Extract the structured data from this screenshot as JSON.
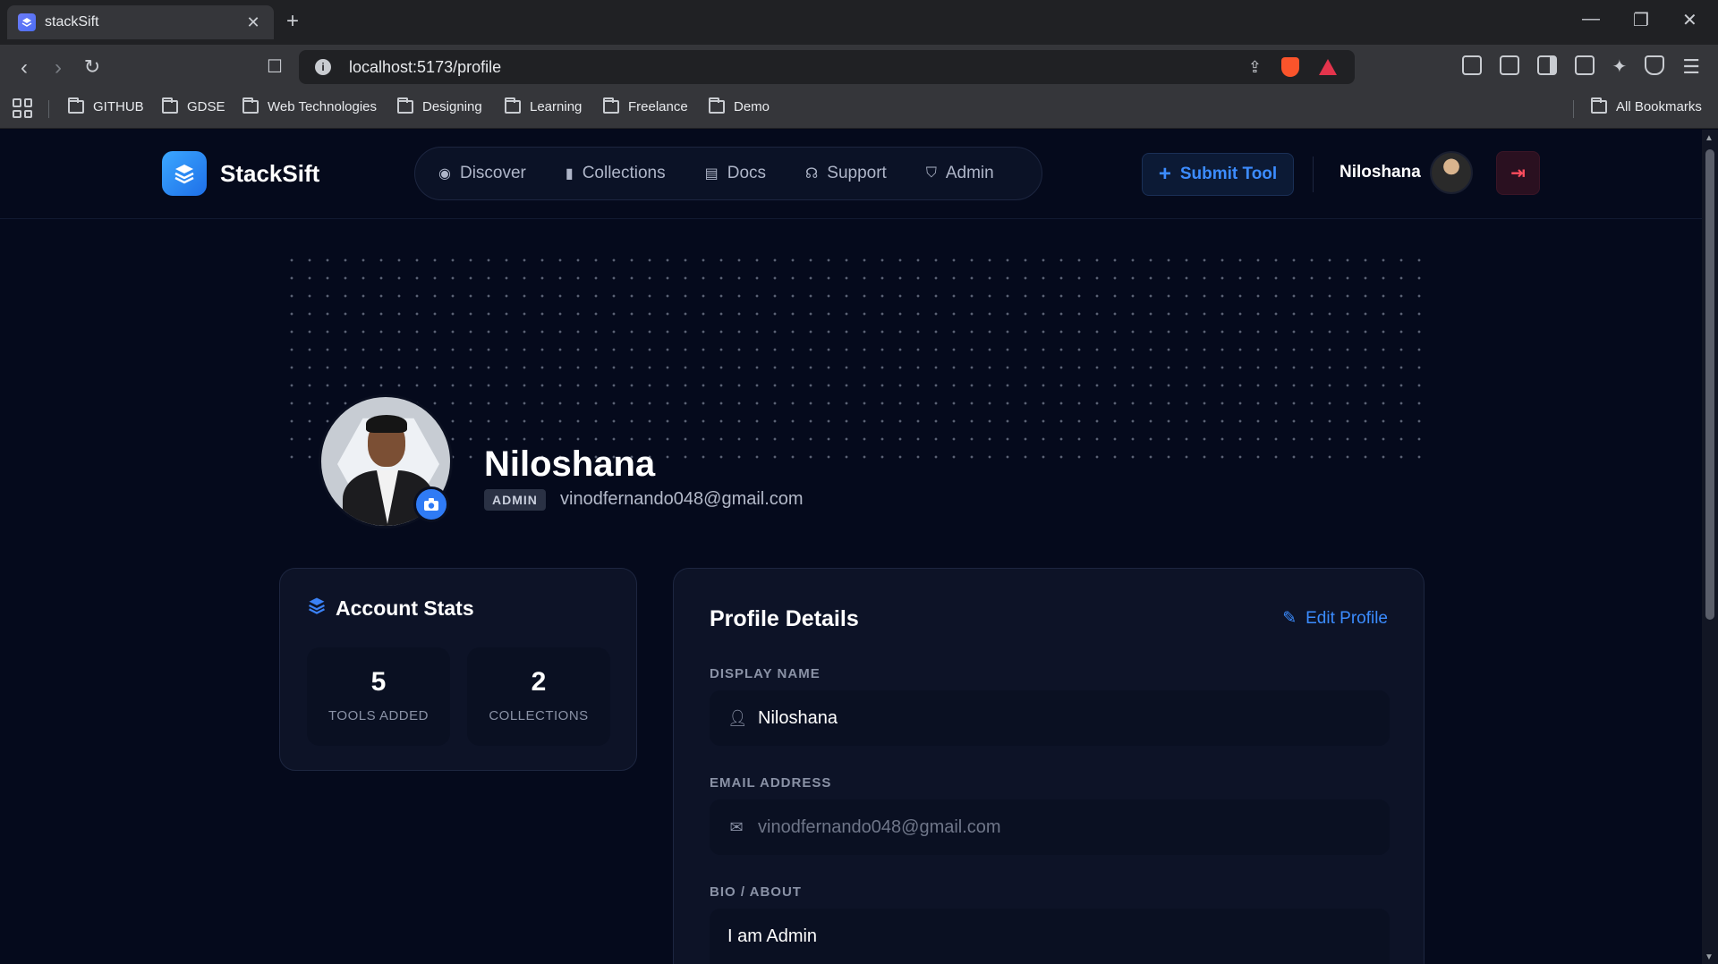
{
  "browser": {
    "tab_title": "stackSift",
    "url": "localhost:5173/profile",
    "bookmarks": [
      "GITHUB",
      "GDSE",
      "Web Technologies",
      "Designing",
      "Learning",
      "Freelance",
      "Demo"
    ],
    "all_bookmarks": "All Bookmarks"
  },
  "app": {
    "brand": "StackSift",
    "nav": [
      {
        "label": "Discover",
        "icon": "compass-icon"
      },
      {
        "label": "Collections",
        "icon": "bookmark-icon"
      },
      {
        "label": "Docs",
        "icon": "doc-icon"
      },
      {
        "label": "Support",
        "icon": "headset-icon"
      },
      {
        "label": "Admin",
        "icon": "shield-icon"
      }
    ],
    "submit_label": "Submit Tool",
    "user_name": "Niloshana"
  },
  "profile": {
    "name": "Niloshana",
    "role": "ADMIN",
    "email": "vinodfernando048@gmail.com"
  },
  "stats": {
    "title": "Account Stats",
    "items": [
      {
        "value": "5",
        "label": "TOOLS ADDED"
      },
      {
        "value": "2",
        "label": "COLLECTIONS"
      }
    ]
  },
  "details": {
    "title": "Profile Details",
    "edit_label": "Edit Profile",
    "display_name_label": "DISPLAY NAME",
    "display_name_value": "Niloshana",
    "email_label": "EMAIL ADDRESS",
    "email_value": "vinodfernando048@gmail.com",
    "bio_label": "BIO / ABOUT",
    "bio_value": "I am Admin"
  },
  "colors": {
    "accent": "#3b8cff",
    "background": "#050a1c",
    "card": "#0d1327",
    "danger": "#ff4d5e"
  }
}
